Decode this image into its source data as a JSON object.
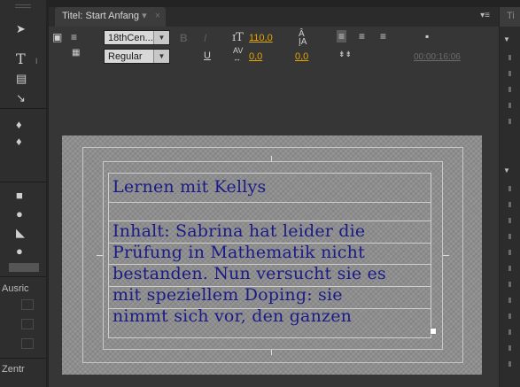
{
  "tab": {
    "title": "Titel: Start Anfang",
    "menu_glyph": "▾",
    "close_glyph": "×"
  },
  "panel_menu": "▾≡",
  "toolbar": {
    "font_family": "18thCen...",
    "font_style": "Regular",
    "bold": "B",
    "italic": "I",
    "underline": "U",
    "font_size": "110,0",
    "tracking": "0,0",
    "leading": "0,0",
    "kerning_label": "AV",
    "timecode": "00:00:16:06"
  },
  "left_panel": {
    "align_label": "Ausric",
    "center_label": "Zentr"
  },
  "right_panel": {
    "tab_title": "Ti"
  },
  "title_text": {
    "lines": [
      "Lernen mit Kellys",
      "Inhalt: Sabrina hat leider die",
      "Prüfung in Mathematik nicht",
      "bestanden. Nun versucht sie es",
      "mit speziellem Doping: sie",
      "nimmt sich vor, den ganzen"
    ]
  },
  "colors": {
    "accent": "#e5a400",
    "title_text": "#1a1a88"
  }
}
